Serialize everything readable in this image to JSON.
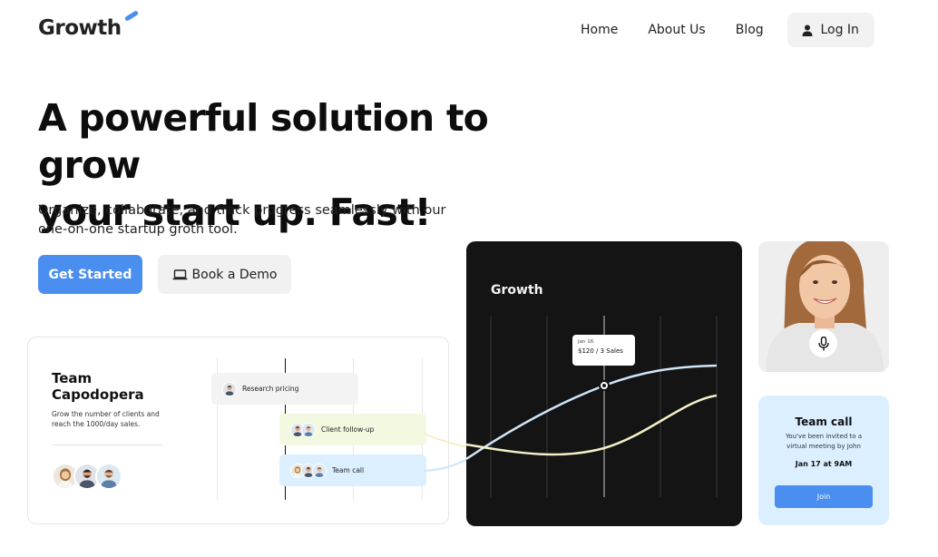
{
  "brand": {
    "name": "Growth",
    "accent": "#4a8ef0"
  },
  "nav": {
    "links": [
      "Home",
      "About Us",
      "Blog"
    ],
    "login_label": "Log In",
    "login_icon": "user-icon"
  },
  "hero": {
    "headline_line1": "A powerful solution to grow",
    "headline_line2": "your start up. Fast!",
    "subtitle_line1": "Organize, collaborate, and track progress seamlessly with our",
    "subtitle_line2": "one-on-one startup groth tool.",
    "primary_cta": "Get Started",
    "secondary_cta": "Book a Demo",
    "secondary_icon": "laptop-icon"
  },
  "team_card": {
    "title_line1": "Team",
    "title_line2": "Capodopera",
    "description": "Grow the number of clients and reach the 1000/day sales.",
    "tasks": [
      {
        "label": "Research pricing",
        "color": "#f3f3f3"
      },
      {
        "label": "Client follow-up",
        "color": "#f3f9e0"
      },
      {
        "label": "Team call",
        "color": "#dcefff"
      }
    ]
  },
  "chart_card": {
    "title": "Growth",
    "tooltip_date": "Jan 16",
    "tooltip_value": "$120 / 3 Sales",
    "colors": {
      "background": "#141414",
      "line_blue": "#cfe6f7",
      "line_cream": "#f5f0c8"
    }
  },
  "portrait": {
    "mic_icon": "microphone-icon"
  },
  "call_card": {
    "title": "Team call",
    "description": "You've been invited to a virtual meeting by John",
    "date": "Jan 17 at 9AM",
    "join_label": "Join"
  }
}
